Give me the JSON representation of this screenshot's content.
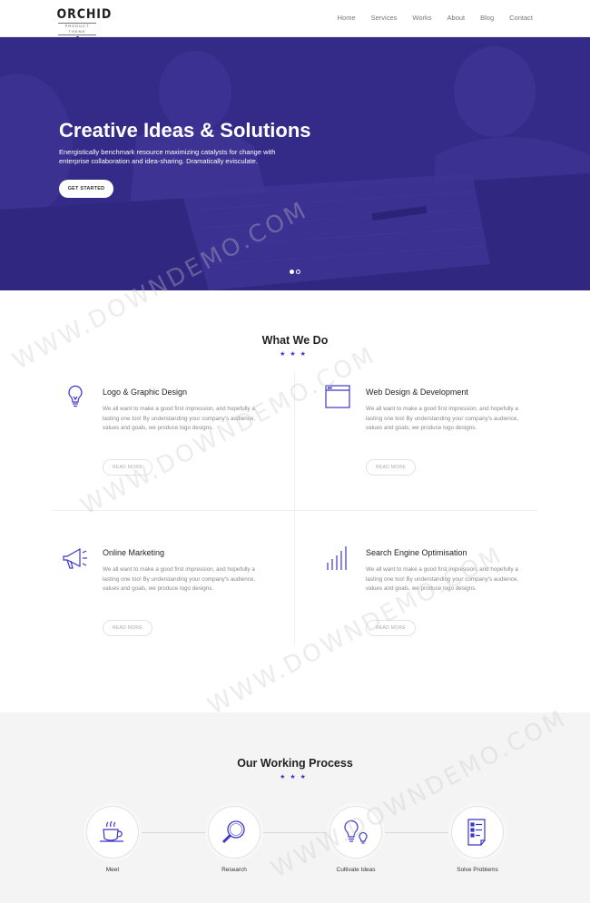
{
  "header": {
    "logo_main": "ORCHID",
    "logo_sub": "PRODUCT THEME",
    "nav": [
      "Home",
      "Services",
      "Works",
      "About",
      "Blog",
      "Contact"
    ]
  },
  "hero": {
    "title": "Creative Ideas & Solutions",
    "text": "Energistically benchmark resource maximizing catalysts for change with enterprise collaboration and idea-sharing. Dramatically evisculate.",
    "button": "GET STARTED",
    "slides": 2,
    "active_slide": 1
  },
  "what_we_do": {
    "title": "What We Do",
    "stars": "★★★",
    "services": [
      {
        "icon": "lightbulb-icon",
        "title": "Logo & Graphic Design",
        "text": "We all want to make a good first impression, and hopefully a lasting one too! By understanding your company's audience, values and goals, we produce logo designs.",
        "button": "READ MORE"
      },
      {
        "icon": "browser-window-icon",
        "title": "Web Design & Development",
        "text": "We all want to make a good first impression, and hopefully a lasting one too! By understanding your company's audience, values and goals, we produce logo designs.",
        "button": "READ MORE"
      },
      {
        "icon": "megaphone-icon",
        "title": "Online Marketing",
        "text": "We all want to make a good first impression, and hopefully a lasting one too! By understanding your company's audience, values and goals, we produce logo designs.",
        "button": "READ MORE"
      },
      {
        "icon": "bar-chart-icon",
        "title": "Search Engine Optimisation",
        "text": "We all want to make a good first impression, and hopefully a lasting one too! By understanding your company's audience, values and goals, we produce logo designs.",
        "button": "READ MORE"
      }
    ]
  },
  "process": {
    "title": "Our Working Process",
    "stars": "★★★",
    "steps": [
      {
        "icon": "coffee-cup-icon",
        "label": "Meet"
      },
      {
        "icon": "magnifier-icon",
        "label": "Research"
      },
      {
        "icon": "light-bulbs-icon",
        "label": "Cultivate Ideas"
      },
      {
        "icon": "checklist-icon",
        "label": "Solve Problems"
      }
    ]
  },
  "watermark": "WWW.DOWNDEMO.COM",
  "colors": {
    "accent": "#3b36c9",
    "hero_overlay": "#332a86",
    "process_bg": "#f4f4f4"
  }
}
